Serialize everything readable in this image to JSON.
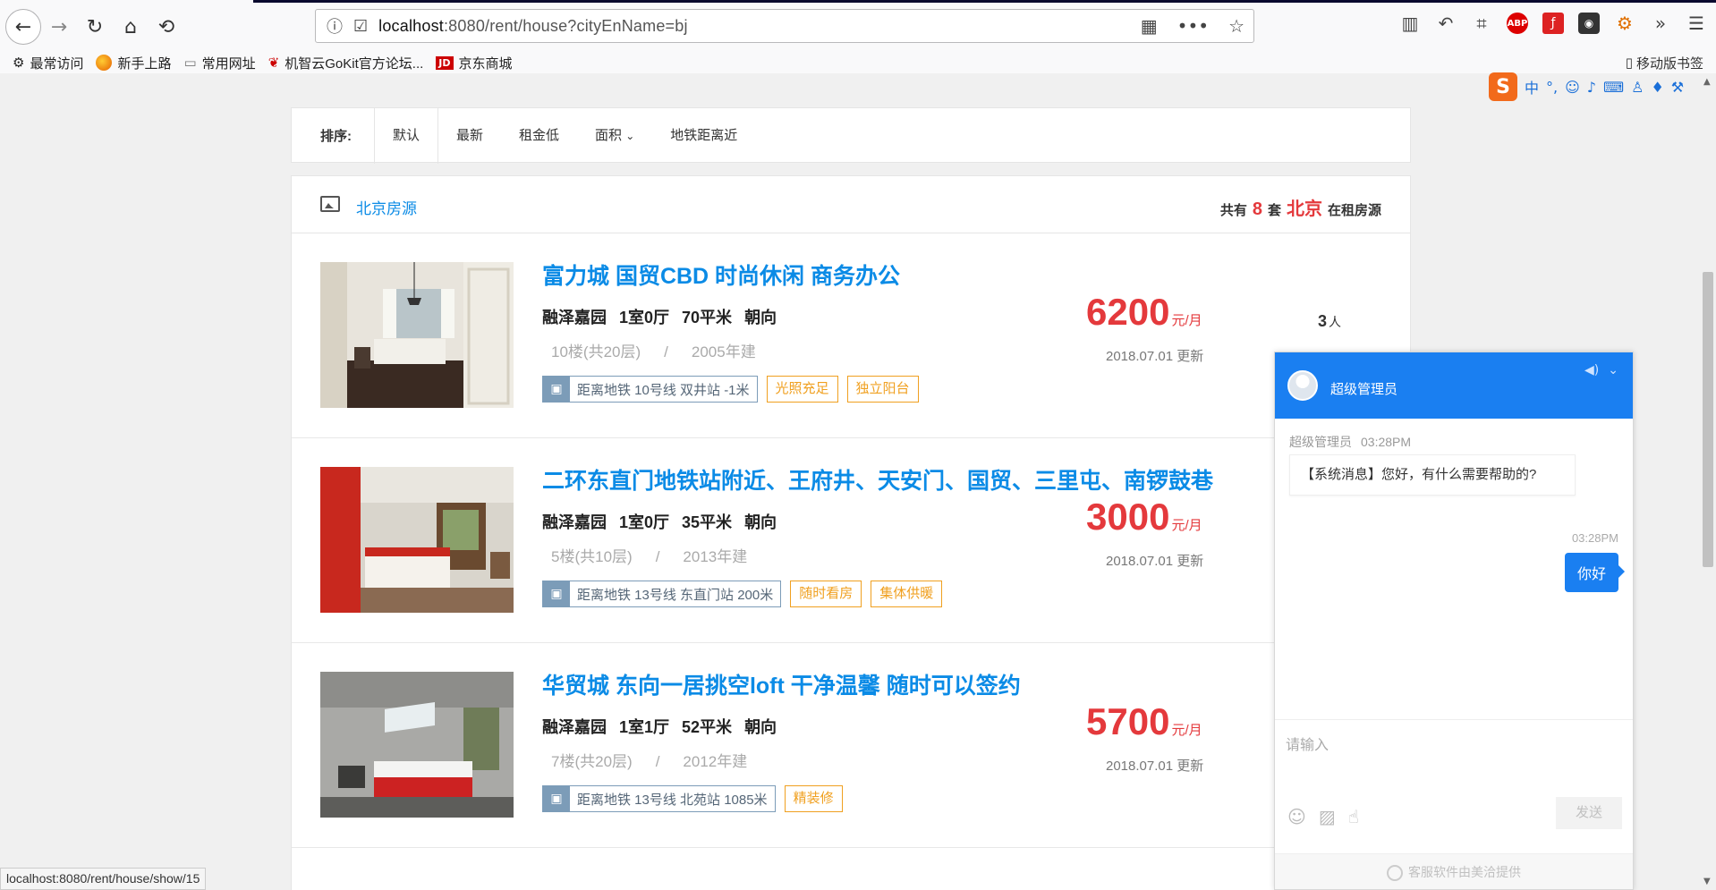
{
  "browser": {
    "url_host": "localhost",
    "url_rest": ":8080/rent/house?cityEnName=bj",
    "bookmarks": [
      "最常访问",
      "新手上路",
      "常用网址",
      "机智云GoKit官方论坛...",
      "京东商城"
    ],
    "mobile_bookmarks": "移动版书签",
    "status_url": "localhost:8080/rent/house/show/15"
  },
  "sort": {
    "label": "排序:",
    "options": [
      "默认",
      "最新",
      "租金低",
      "面积",
      "地铁距离近"
    ]
  },
  "list": {
    "title": "北京房源",
    "count_prefix": "共有",
    "count": "8",
    "count_mid": "套",
    "city": "北京",
    "count_suffix": "在租房源"
  },
  "houses": [
    {
      "title": "富力城 国贸CBD 时尚休闲 商务办公",
      "community": "融泽嘉园",
      "rooms": "1室0厅",
      "area": "70平米",
      "direction": "朝向",
      "floor": "10楼(共20层)",
      "sep": "/",
      "built": "2005年建",
      "metro": "距离地铁 10号线 双井站 -1米",
      "tags": [
        "光照充足",
        "独立阳台"
      ],
      "price": "6200",
      "unit": "元/月",
      "updated": "2018.07.01 更新",
      "people": "3",
      "people_unit": "人"
    },
    {
      "title": "二环东直门地铁站附近、王府井、天安门、国贸、三里屯、南锣鼓巷",
      "community": "融泽嘉园",
      "rooms": "1室0厅",
      "area": "35平米",
      "direction": "朝向",
      "floor": "5楼(共10层)",
      "sep": "/",
      "built": "2013年建",
      "metro": "距离地铁 13号线 东直门站 200米",
      "tags": [
        "随时看房",
        "集体供暖"
      ],
      "price": "3000",
      "unit": "元/月",
      "updated": "2018.07.01 更新"
    },
    {
      "title": "华贸城 东向一居挑空loft 干净温馨 随时可以签约",
      "community": "融泽嘉园",
      "rooms": "1室1厅",
      "area": "52平米",
      "direction": "朝向",
      "floor": "7楼(共20层)",
      "sep": "/",
      "built": "2012年建",
      "metro": "距离地铁 13号线 北苑站 1085米",
      "tags": [
        "精装修"
      ],
      "price": "5700",
      "unit": "元/月",
      "updated": "2018.07.01 更新"
    }
  ],
  "chat": {
    "agent_name": "超级管理员",
    "meta_name": "超级管理员",
    "meta_time": "03:28PM",
    "incoming": "【系统消息】您好，有什么需要帮助的?",
    "out_time": "03:28PM",
    "outgoing": "你好",
    "placeholder": "请输入",
    "send": "发送",
    "footer": "客服软件由美洽提供"
  },
  "ime": {
    "logo": "S",
    "lang": "中"
  }
}
